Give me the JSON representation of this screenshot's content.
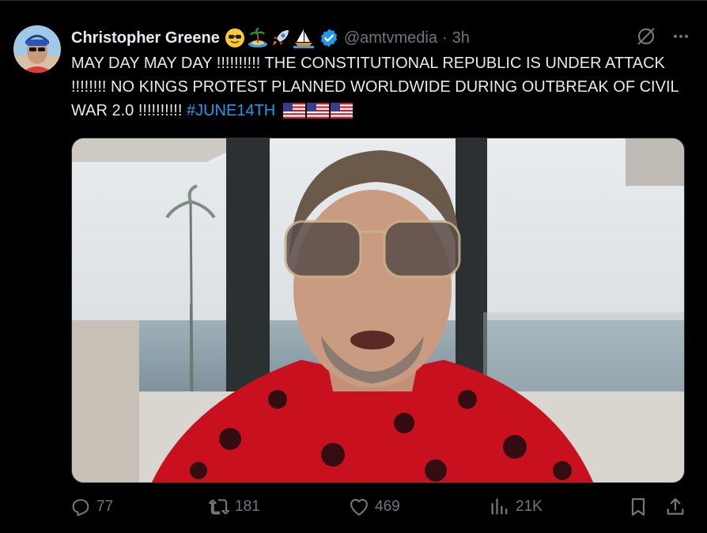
{
  "author": {
    "display_name": "Christopher Greene",
    "handle": "@amtvmedia",
    "separator": "·",
    "time_ago": "3h",
    "name_emojis": [
      "smiling-face-with-sunglasses-emoji",
      "desert-island-emoji",
      "rocket-emoji",
      "sailboat-emoji"
    ],
    "verified": true,
    "verified_color": "#1d9bf0"
  },
  "tweet": {
    "text": "MAY DAY MAY DAY !!!!!!!!!! THE CONSTITUTIONAL REPUBLIC IS UNDER ATTACK !!!!!!!! NO KINGS PROTEST PLANNED WORLDWIDE DURING OUTBREAK OF CIVIL WAR 2.0 !!!!!!!!!! ",
    "hashtag": "#JUNE14TH",
    "trailing_emojis": [
      "us-flag-emoji",
      "us-flag-emoji",
      "us-flag-emoji"
    ]
  },
  "actions": {
    "replies": "77",
    "reposts": "181",
    "likes": "469",
    "views": "21K"
  },
  "colors": {
    "background": "#000000",
    "text": "#e7e9ea",
    "muted": "#71767b",
    "accent": "#1d9bf0",
    "shirt": "#c8101e"
  }
}
